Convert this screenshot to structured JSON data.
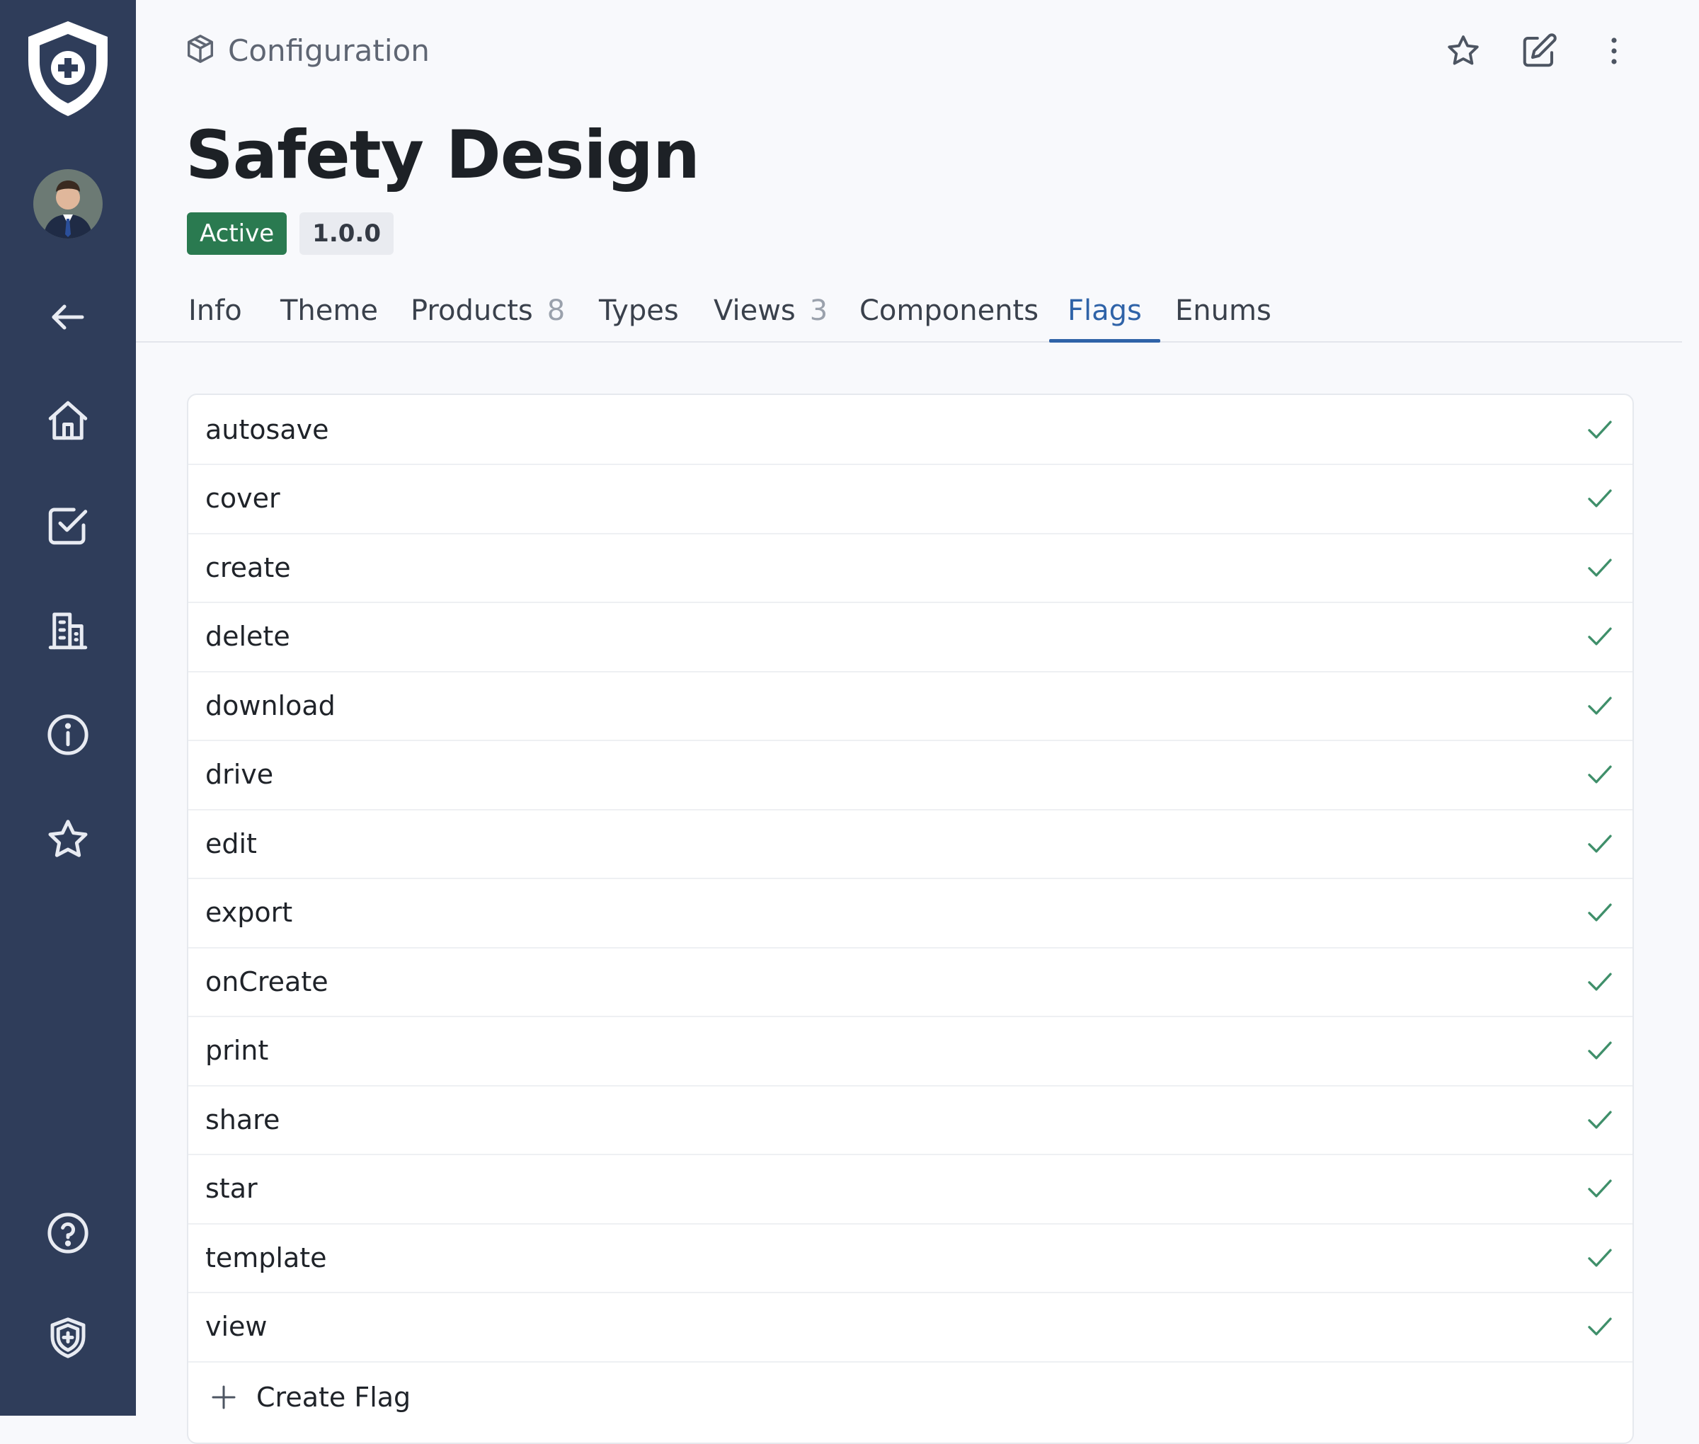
{
  "sidebar": {
    "logo_icon": "shield-plus-icon",
    "avatar_icon": "user-avatar",
    "items": [
      {
        "name": "back-arrow-icon"
      },
      {
        "name": "home-icon"
      },
      {
        "name": "tasks-icon"
      },
      {
        "name": "buildings-icon"
      },
      {
        "name": "info-icon"
      },
      {
        "name": "star-icon"
      }
    ],
    "bottom": [
      {
        "name": "help-icon"
      },
      {
        "name": "shield-icon"
      }
    ]
  },
  "header": {
    "breadcrumb": "Configuration",
    "breadcrumb_icon": "cube-icon",
    "actions": [
      "star-icon",
      "edit-icon",
      "more-vertical-icon"
    ]
  },
  "page": {
    "title": "Safety Design",
    "status": "Active",
    "version": "1.0.0"
  },
  "tabs": [
    {
      "label": "Info",
      "count": ""
    },
    {
      "label": "Theme",
      "count": ""
    },
    {
      "label": "Products",
      "count": "8"
    },
    {
      "label": "Types",
      "count": ""
    },
    {
      "label": "Views",
      "count": "3"
    },
    {
      "label": "Components",
      "count": ""
    },
    {
      "label": "Flags",
      "count": "",
      "active": true
    },
    {
      "label": "Enums",
      "count": ""
    }
  ],
  "flags": [
    {
      "name": "autosave",
      "enabled": true
    },
    {
      "name": "cover",
      "enabled": true
    },
    {
      "name": "create",
      "enabled": true
    },
    {
      "name": "delete",
      "enabled": true
    },
    {
      "name": "download",
      "enabled": true
    },
    {
      "name": "drive",
      "enabled": true
    },
    {
      "name": "edit",
      "enabled": true
    },
    {
      "name": "export",
      "enabled": true
    },
    {
      "name": "onCreate",
      "enabled": true
    },
    {
      "name": "print",
      "enabled": true
    },
    {
      "name": "share",
      "enabled": true
    },
    {
      "name": "star",
      "enabled": true
    },
    {
      "name": "template",
      "enabled": true
    },
    {
      "name": "view",
      "enabled": true
    }
  ],
  "create_flag_label": "Create Flag",
  "colors": {
    "sidebar_bg": "#2f3d5a",
    "accent": "#2f63a8",
    "status_green": "#2a7a50",
    "check_green": "#3f8f6a"
  }
}
